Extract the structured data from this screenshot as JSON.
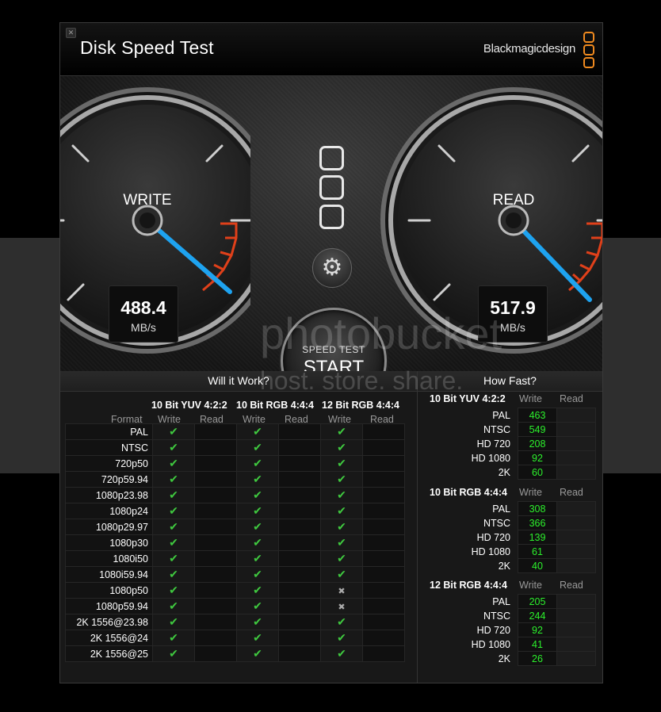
{
  "window": {
    "title": "Disk Speed Test",
    "brand": "Blackmagicdesign",
    "brand_color": "#f08a1f"
  },
  "gauges": {
    "write": {
      "label": "WRITE",
      "value": "488.4",
      "unit": "MB/s"
    },
    "read": {
      "label": "READ",
      "value": "517.9",
      "unit": "MB/s"
    },
    "needle_color": "#1ea3f0",
    "redline_color": "#e0401a"
  },
  "start_button": {
    "small_label": "SPEED TEST",
    "big_label": "START"
  },
  "will_it_work": {
    "title": "Will it Work?",
    "format_header": "Format",
    "groups": [
      "10 Bit YUV 4:2:2",
      "10 Bit RGB 4:4:4",
      "12 Bit RGB 4:4:4"
    ],
    "write_label": "Write",
    "read_label": "Read",
    "rows": [
      {
        "format": "PAL",
        "yuv": true,
        "rgb10": true,
        "rgb12": true
      },
      {
        "format": "NTSC",
        "yuv": true,
        "rgb10": true,
        "rgb12": true
      },
      {
        "format": "720p50",
        "yuv": true,
        "rgb10": true,
        "rgb12": true
      },
      {
        "format": "720p59.94",
        "yuv": true,
        "rgb10": true,
        "rgb12": true
      },
      {
        "format": "1080p23.98",
        "yuv": true,
        "rgb10": true,
        "rgb12": true
      },
      {
        "format": "1080p24",
        "yuv": true,
        "rgb10": true,
        "rgb12": true
      },
      {
        "format": "1080p29.97",
        "yuv": true,
        "rgb10": true,
        "rgb12": true
      },
      {
        "format": "1080p30",
        "yuv": true,
        "rgb10": true,
        "rgb12": true
      },
      {
        "format": "1080i50",
        "yuv": true,
        "rgb10": true,
        "rgb12": true
      },
      {
        "format": "1080i59.94",
        "yuv": true,
        "rgb10": true,
        "rgb12": true
      },
      {
        "format": "1080p50",
        "yuv": true,
        "rgb10": true,
        "rgb12": false
      },
      {
        "format": "1080p59.94",
        "yuv": true,
        "rgb10": true,
        "rgb12": false
      },
      {
        "format": "2K 1556@23.98",
        "yuv": true,
        "rgb10": true,
        "rgb12": true
      },
      {
        "format": "2K 1556@24",
        "yuv": true,
        "rgb10": true,
        "rgb12": true
      },
      {
        "format": "2K 1556@25",
        "yuv": true,
        "rgb10": true,
        "rgb12": true
      }
    ]
  },
  "how_fast": {
    "title": "How Fast?",
    "write_label": "Write",
    "read_label": "Read",
    "groups": [
      {
        "name": "10 Bit YUV 4:2:2",
        "rows": [
          {
            "format": "PAL",
            "write": "463"
          },
          {
            "format": "NTSC",
            "write": "549"
          },
          {
            "format": "HD 720",
            "write": "208"
          },
          {
            "format": "HD 1080",
            "write": "92"
          },
          {
            "format": "2K",
            "write": "60"
          }
        ]
      },
      {
        "name": "10 Bit RGB 4:4:4",
        "rows": [
          {
            "format": "PAL",
            "write": "308"
          },
          {
            "format": "NTSC",
            "write": "366"
          },
          {
            "format": "HD 720",
            "write": "139"
          },
          {
            "format": "HD 1080",
            "write": "61"
          },
          {
            "format": "2K",
            "write": "40"
          }
        ]
      },
      {
        "name": "12 Bit RGB 4:4:4",
        "rows": [
          {
            "format": "PAL",
            "write": "205"
          },
          {
            "format": "NTSC",
            "write": "244"
          },
          {
            "format": "HD 720",
            "write": "92"
          },
          {
            "format": "HD 1080",
            "write": "41"
          },
          {
            "format": "2K",
            "write": "26"
          }
        ]
      }
    ]
  },
  "watermark": {
    "line1": "photobucket",
    "line2": "host. store. share."
  }
}
